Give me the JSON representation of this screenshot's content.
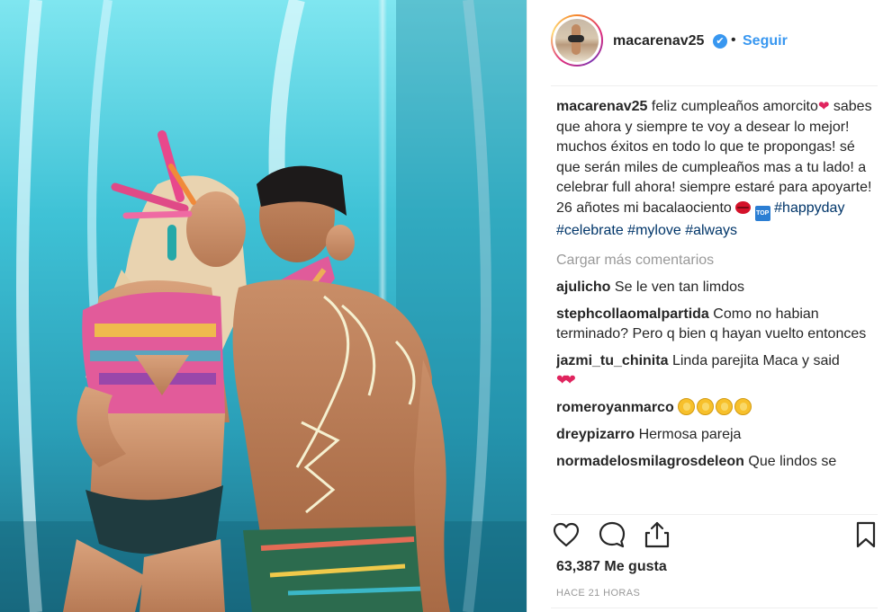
{
  "post": {
    "username": "macarenav25",
    "verified_glyph": "✔",
    "dot": "•",
    "follow_label": "Seguir",
    "caption": {
      "username": "macarenav25",
      "text_1": "feliz cumpleaños amorcito",
      "text_2": "sabes que ahora y siempre te voy a desear lo mejor! muchos éxitos en todo lo que te propongas! sé que serán miles de cumpleaños mas a tu lado! a celebrar full ahora! siempre estaré para apoyarte! 26 añotes mi bacalaociento",
      "top_badge": "TOP",
      "hashtags": [
        "#happyday",
        "#celebrate",
        "#mylove",
        "#always"
      ]
    },
    "load_more_label": "Cargar más comentarios",
    "comments": [
      {
        "user": "ajulicho",
        "text": "Se le ven tan limdos"
      },
      {
        "user": "stephcollaomalpartida",
        "text": "Como no habian terminado? Pero q bien q hayan vuelto entonces"
      },
      {
        "user": "jazmi_tu_chinita",
        "text": "Linda parejita Maca y said"
      },
      {
        "user": "romeroyanmarco",
        "text": ""
      },
      {
        "user": "dreypizarro",
        "text": "Hermosa pareja"
      },
      {
        "user": "normadelosmilagrosdeleon",
        "text": "Que lindos se"
      }
    ],
    "likes": "63,387 Me gusta",
    "time": "HACE 21 HORAS",
    "icons": {
      "like": "heart-outline-icon",
      "comment": "speech-bubble-icon",
      "share": "share-upload-icon",
      "save": "bookmark-icon"
    },
    "colors": {
      "link_blue": "#3897f0",
      "hashtag": "#003569",
      "muted": "#999999",
      "text": "#262626"
    }
  }
}
